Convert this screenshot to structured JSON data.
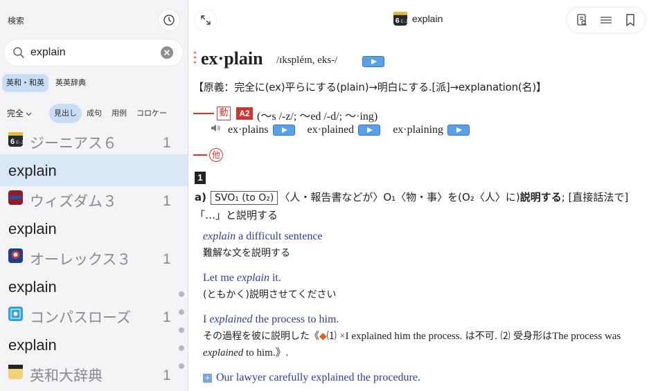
{
  "sidebar": {
    "title": "検索",
    "search": {
      "value": "explain"
    },
    "dict_tabs": [
      "英和・和英",
      "英英辞典"
    ],
    "match_mode": "完全",
    "mode_tabs": [
      "見出し",
      "成句",
      "用例",
      "コロケー"
    ],
    "results": [
      {
        "dictionary": "ジーニアス６",
        "count": "1",
        "word": "explain",
        "selected": true
      },
      {
        "dictionary": "ウィズダム３",
        "count": "1",
        "word": "explain"
      },
      {
        "dictionary": "オーレックス３",
        "count": "1",
        "word": "explain"
      },
      {
        "dictionary": "コンパスローズ",
        "count": "1",
        "word": "explain"
      },
      {
        "dictionary": "英和大辞典",
        "count": "1"
      }
    ]
  },
  "main": {
    "title": "explain",
    "entry": {
      "headword": "ex·plain",
      "pronunciation": "/ɪkspléɪn, eks-/",
      "etymology": "【原義：完全に(ex)平らにする(plain)→明白にする.[派]→explanation(名)】",
      "pos1": "動",
      "level": "A2",
      "inflection": "(〜s /-z/; 〜ed /-d/; 〜·ing)",
      "forms": [
        "ex·plains",
        "ex·plained",
        "ex·plaining"
      ],
      "pos2": "他",
      "sense_number": "1",
      "sense_label": "a)",
      "pattern_box": "SVO₁ (to O₂)",
      "definition_rest": "〈人・報告書などが〉O₁〈物・事〉を(O₂〈人〉に)",
      "definition_bold": "説明する",
      "definition_tail": "; [直接話法で]「…」と説明する",
      "examples": [
        {
          "en_pre": "",
          "en_italic": "explain",
          "en_post": " a difficult sentence",
          "ja": "難解な文を説明する"
        },
        {
          "en_pre": "Let me ",
          "en_italic": "explain",
          "en_post": " it.",
          "ja": "(ともかく)説明させてください"
        },
        {
          "en_pre": "I ",
          "en_italic": "explained",
          "en_post": " the process to him.",
          "ja": ""
        }
      ],
      "note": {
        "ja_pre": "その過程を彼に説明した《",
        "diamond": "◆",
        "n1": "⑴ ",
        "cross": "×",
        "wrong_ex": "I explained him the process.",
        "ja_mid": " は不可. ⑵ 受身形は",
        "the": "The process was ",
        "italic": "explained",
        "tail": " to him.》."
      },
      "more_example": "Our lawyer carefully explained the procedure."
    }
  }
}
